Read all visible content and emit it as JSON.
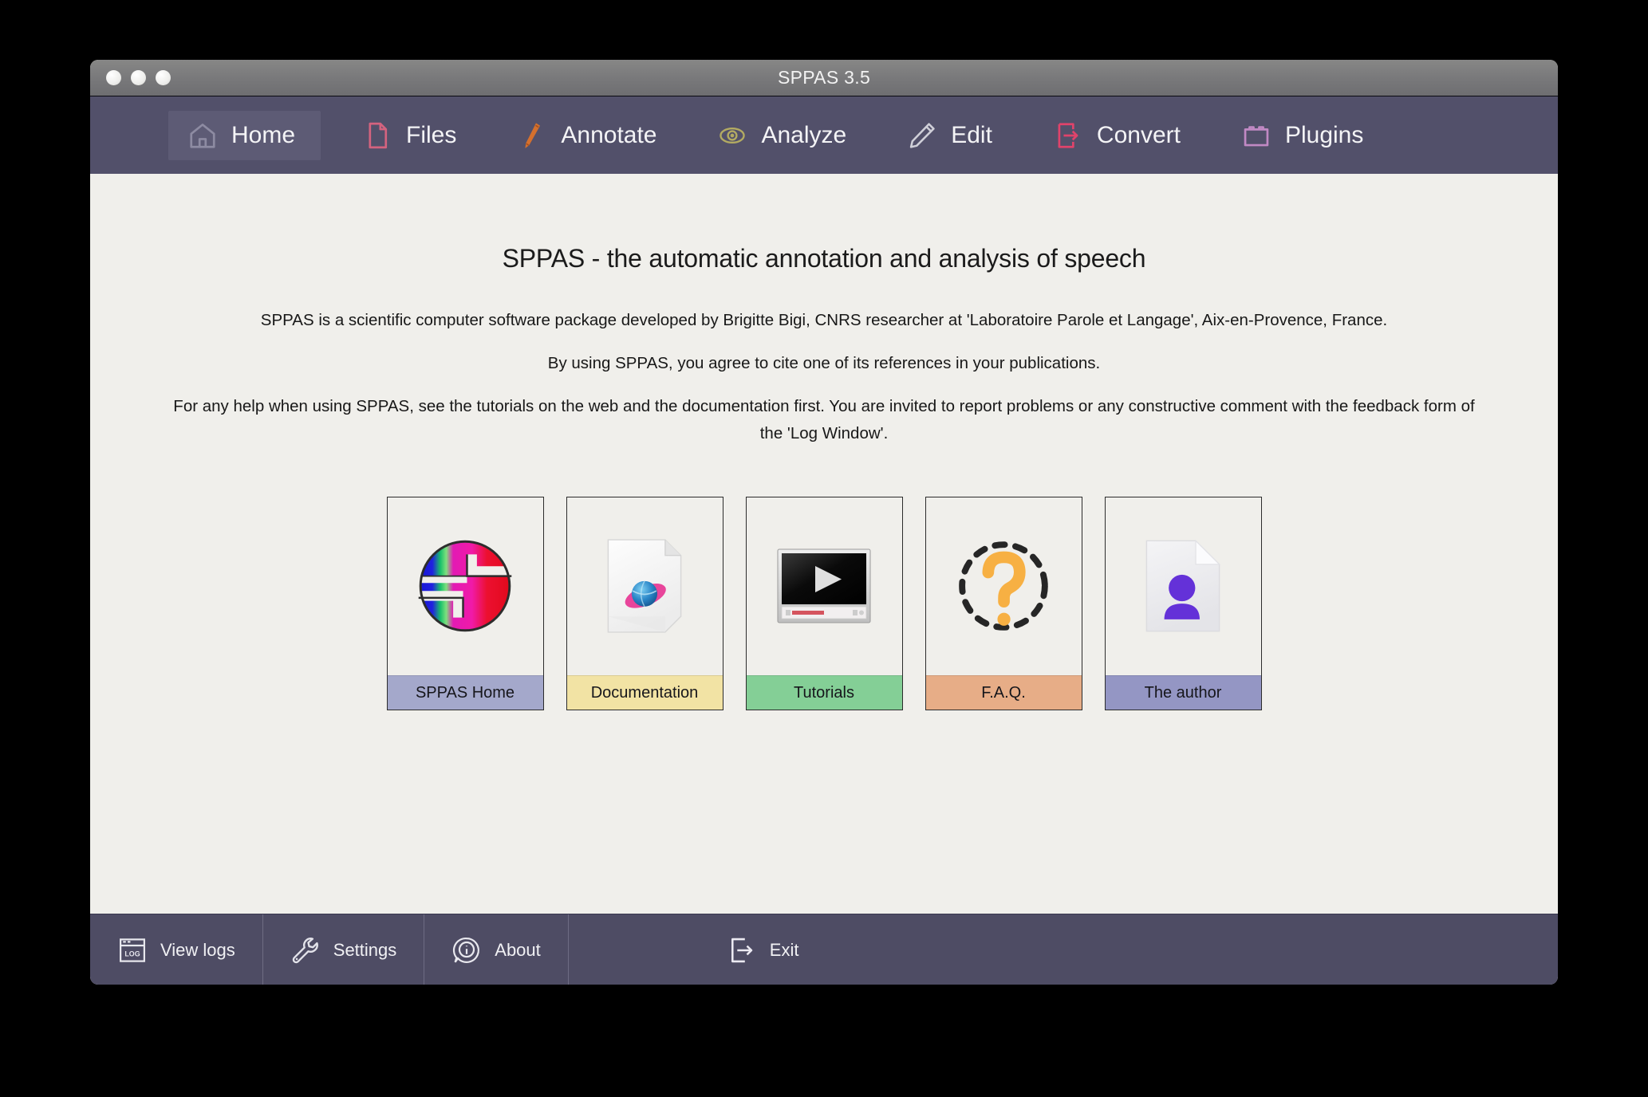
{
  "window": {
    "title": "SPPAS 3.5",
    "traffic_lights": [
      "close",
      "minimize",
      "zoom"
    ]
  },
  "toolbar": {
    "tabs": [
      {
        "label": "Home",
        "icon": "home-icon",
        "selected": true
      },
      {
        "label": "Files",
        "icon": "file-icon",
        "selected": false
      },
      {
        "label": "Annotate",
        "icon": "pen-icon",
        "selected": false
      },
      {
        "label": "Analyze",
        "icon": "eye-icon",
        "selected": false
      },
      {
        "label": "Edit",
        "icon": "pencil-icon",
        "selected": false
      },
      {
        "label": "Convert",
        "icon": "export-icon",
        "selected": false
      },
      {
        "label": "Plugins",
        "icon": "lego-icon",
        "selected": false
      }
    ]
  },
  "main": {
    "heading": "SPPAS - the automatic annotation and analysis of speech",
    "paragraphs": [
      "SPPAS is a scientific computer software package developed by Brigitte Bigi, CNRS researcher at 'Laboratoire Parole et Langage', Aix-en-Provence, France.",
      "By using SPPAS, you agree to cite one of its references in your publications.",
      "For any help when using SPPAS, see the tutorials on the web and the documentation first. You are invited to report problems or any constructive comment with the feedback form of the 'Log Window'."
    ],
    "cards": [
      {
        "label": "SPPAS Home",
        "icon": "sppas-logo-icon",
        "label_color": "#a4a8cb"
      },
      {
        "label": "Documentation",
        "icon": "document-web-icon",
        "label_color": "#f2e3a4"
      },
      {
        "label": "Tutorials",
        "icon": "video-play-icon",
        "label_color": "#84cf96"
      },
      {
        "label": "F.A.Q.",
        "icon": "question-icon",
        "label_color": "#e7ad87"
      },
      {
        "label": "The author",
        "icon": "person-card-icon",
        "label_color": "#9496c4"
      }
    ]
  },
  "bottombar": {
    "items": [
      {
        "label": "View logs",
        "icon": "log-window-icon"
      },
      {
        "label": "Settings",
        "icon": "wrench-icon"
      },
      {
        "label": "About",
        "icon": "info-bubble-icon"
      },
      {
        "label": "Exit",
        "icon": "exit-door-icon"
      }
    ]
  },
  "colors": {
    "toolbar_bg": "#52506a",
    "toolbar_selected": "#5d5b75",
    "content_bg": "#f0efeb",
    "bottombar_bg": "#4e4c64",
    "titlebar_bg": "#78787a",
    "accent_files": "#d4637f",
    "accent_annotate": "#d4702e",
    "accent_analyze": "#b3ab62",
    "accent_edit": "#cfcfd8",
    "accent_convert": "#e0436b",
    "accent_plugins": "#c189c4"
  }
}
